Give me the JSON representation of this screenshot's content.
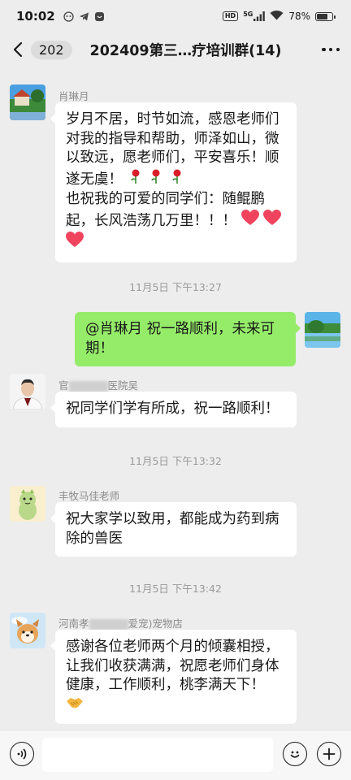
{
  "status_bar": {
    "time": "10:02",
    "network": "5G",
    "battery": "78%",
    "battery_level": 0.78
  },
  "nav": {
    "unread_count": "202",
    "title": "202409第三…疗培训群(14)"
  },
  "messages": [
    {
      "sender": "肖琳月",
      "lines": [
        "岁月不居，时节如流，感恩老师们",
        "对我的指导和帮助，师泽如山，微",
        "以致远，愿老师们，平安喜乐！顺",
        "遂无虞！"
      ],
      "lines2": [
        "也祝我的可爱的同学们：随鲲鹏",
        "起，长风浩荡几万里！！！"
      ]
    },
    {
      "timestamp": "11月5日 下午13:27"
    },
    {
      "lines": [
        "@肖琳月  祝一路顺利，未来可",
        "期！"
      ]
    },
    {
      "sender_prefix": "官",
      "sender_suffix": "医院吴",
      "lines": [
        "祝同学们学有所成，祝一路顺利！"
      ]
    },
    {
      "timestamp": "11月5日 下午13:32"
    },
    {
      "sender": "丰牧马佳老师",
      "lines": [
        "祝大家学以致用，都能成为药到病",
        "除的兽医"
      ]
    },
    {
      "timestamp": "11月5日 下午13:42"
    },
    {
      "sender_prefix": "河南孝",
      "sender_suffix": "爱宠)宠物店",
      "lines": [
        "感谢各位老师两个月的倾囊相授，",
        "让我们收获满满，祝愿老师们身体",
        "健康，工作顺利，桃李满天下！"
      ]
    }
  ],
  "input": {
    "placeholder": ""
  }
}
